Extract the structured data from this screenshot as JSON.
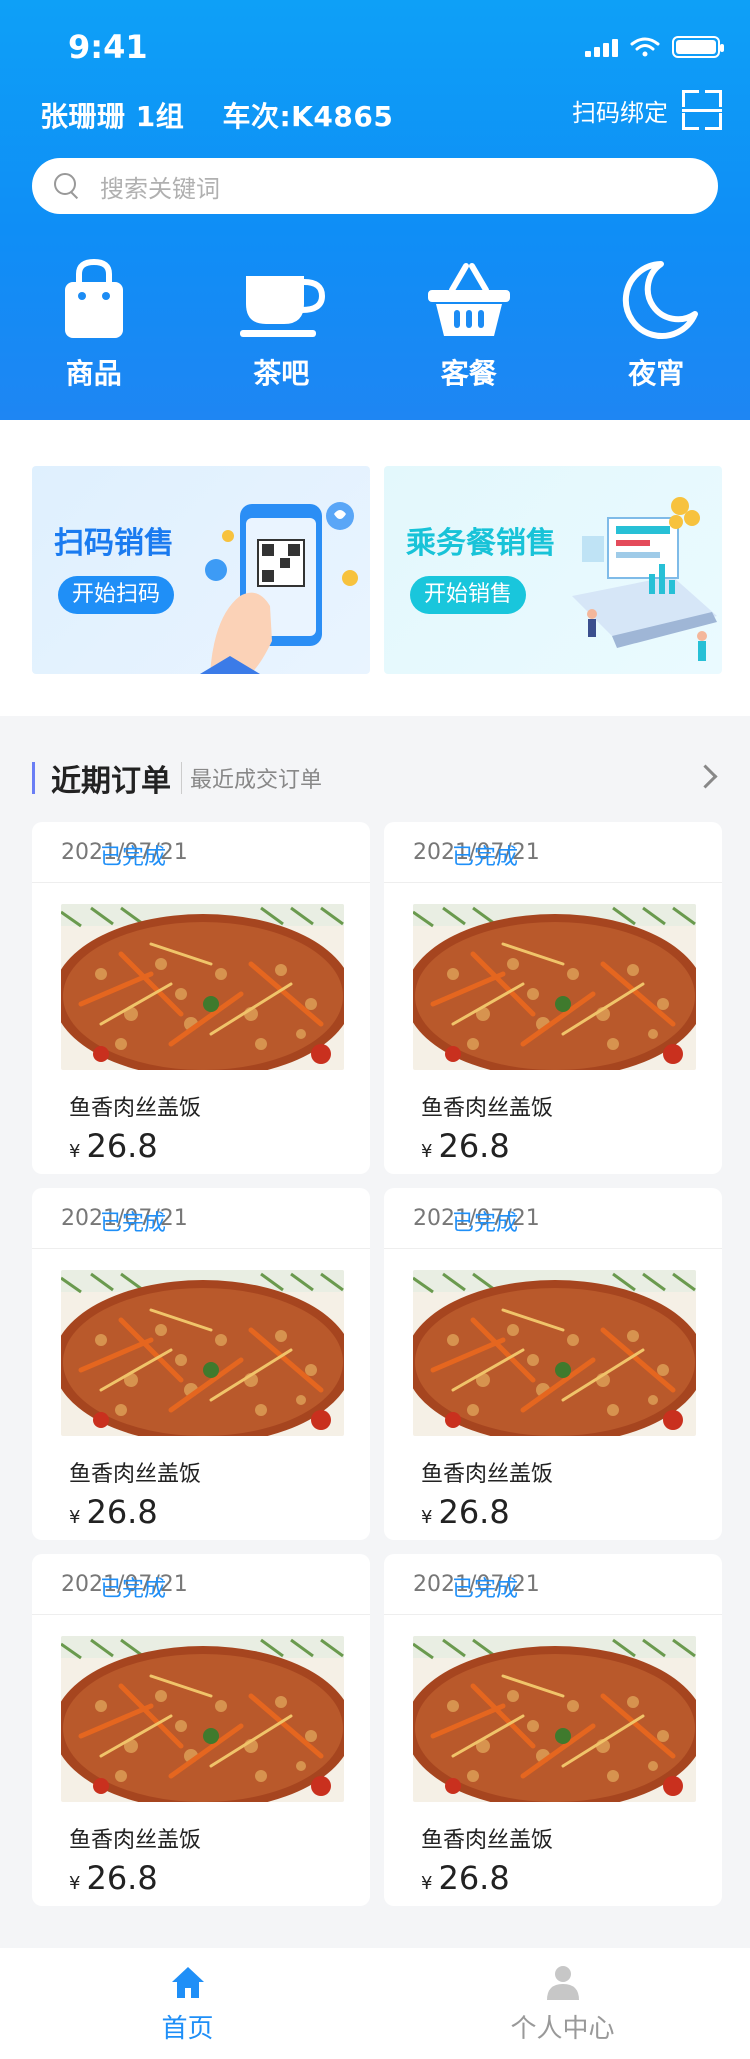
{
  "status_bar": {
    "time": "9:41"
  },
  "header": {
    "user": "张珊珊 1组",
    "train": "车次:K4865",
    "bind_label": "扫码绑定"
  },
  "search": {
    "placeholder": "搜索关键词"
  },
  "categories": [
    {
      "label": "商品",
      "icon": "shopping-bag-icon"
    },
    {
      "label": "茶吧",
      "icon": "coffee-cup-icon"
    },
    {
      "label": "客餐",
      "icon": "basket-icon"
    },
    {
      "label": "夜宵",
      "icon": "moon-icon"
    }
  ],
  "banners": [
    {
      "title": "扫码销售",
      "button": "开始扫码"
    },
    {
      "title": "乘务餐销售",
      "button": "开始销售"
    }
  ],
  "recent": {
    "title": "近期订单",
    "subtitle": "最近成交订单",
    "orders": [
      {
        "date": "2021/07/21",
        "status": "已完成",
        "name": "鱼香肉丝盖饭",
        "currency": "¥",
        "price": "26.8"
      },
      {
        "date": "2021/07/21",
        "status": "已完成",
        "name": "鱼香肉丝盖饭",
        "currency": "¥",
        "price": "26.8"
      },
      {
        "date": "2021/07/21",
        "status": "已完成",
        "name": "鱼香肉丝盖饭",
        "currency": "¥",
        "price": "26.8"
      },
      {
        "date": "2021/07/21",
        "status": "已完成",
        "name": "鱼香肉丝盖饭",
        "currency": "¥",
        "price": "26.8"
      },
      {
        "date": "2021/07/21",
        "status": "已完成",
        "name": "鱼香肉丝盖饭",
        "currency": "¥",
        "price": "26.8"
      },
      {
        "date": "2021/07/21",
        "status": "已完成",
        "name": "鱼香肉丝盖饭",
        "currency": "¥",
        "price": "26.8"
      }
    ]
  },
  "tabbar": [
    {
      "label": "首页",
      "icon": "home-icon",
      "active": true
    },
    {
      "label": "个人中心",
      "icon": "person-icon",
      "active": false
    }
  ],
  "colors": {
    "primary": "#1f8ff7",
    "accent_cyan": "#19c6dc"
  }
}
